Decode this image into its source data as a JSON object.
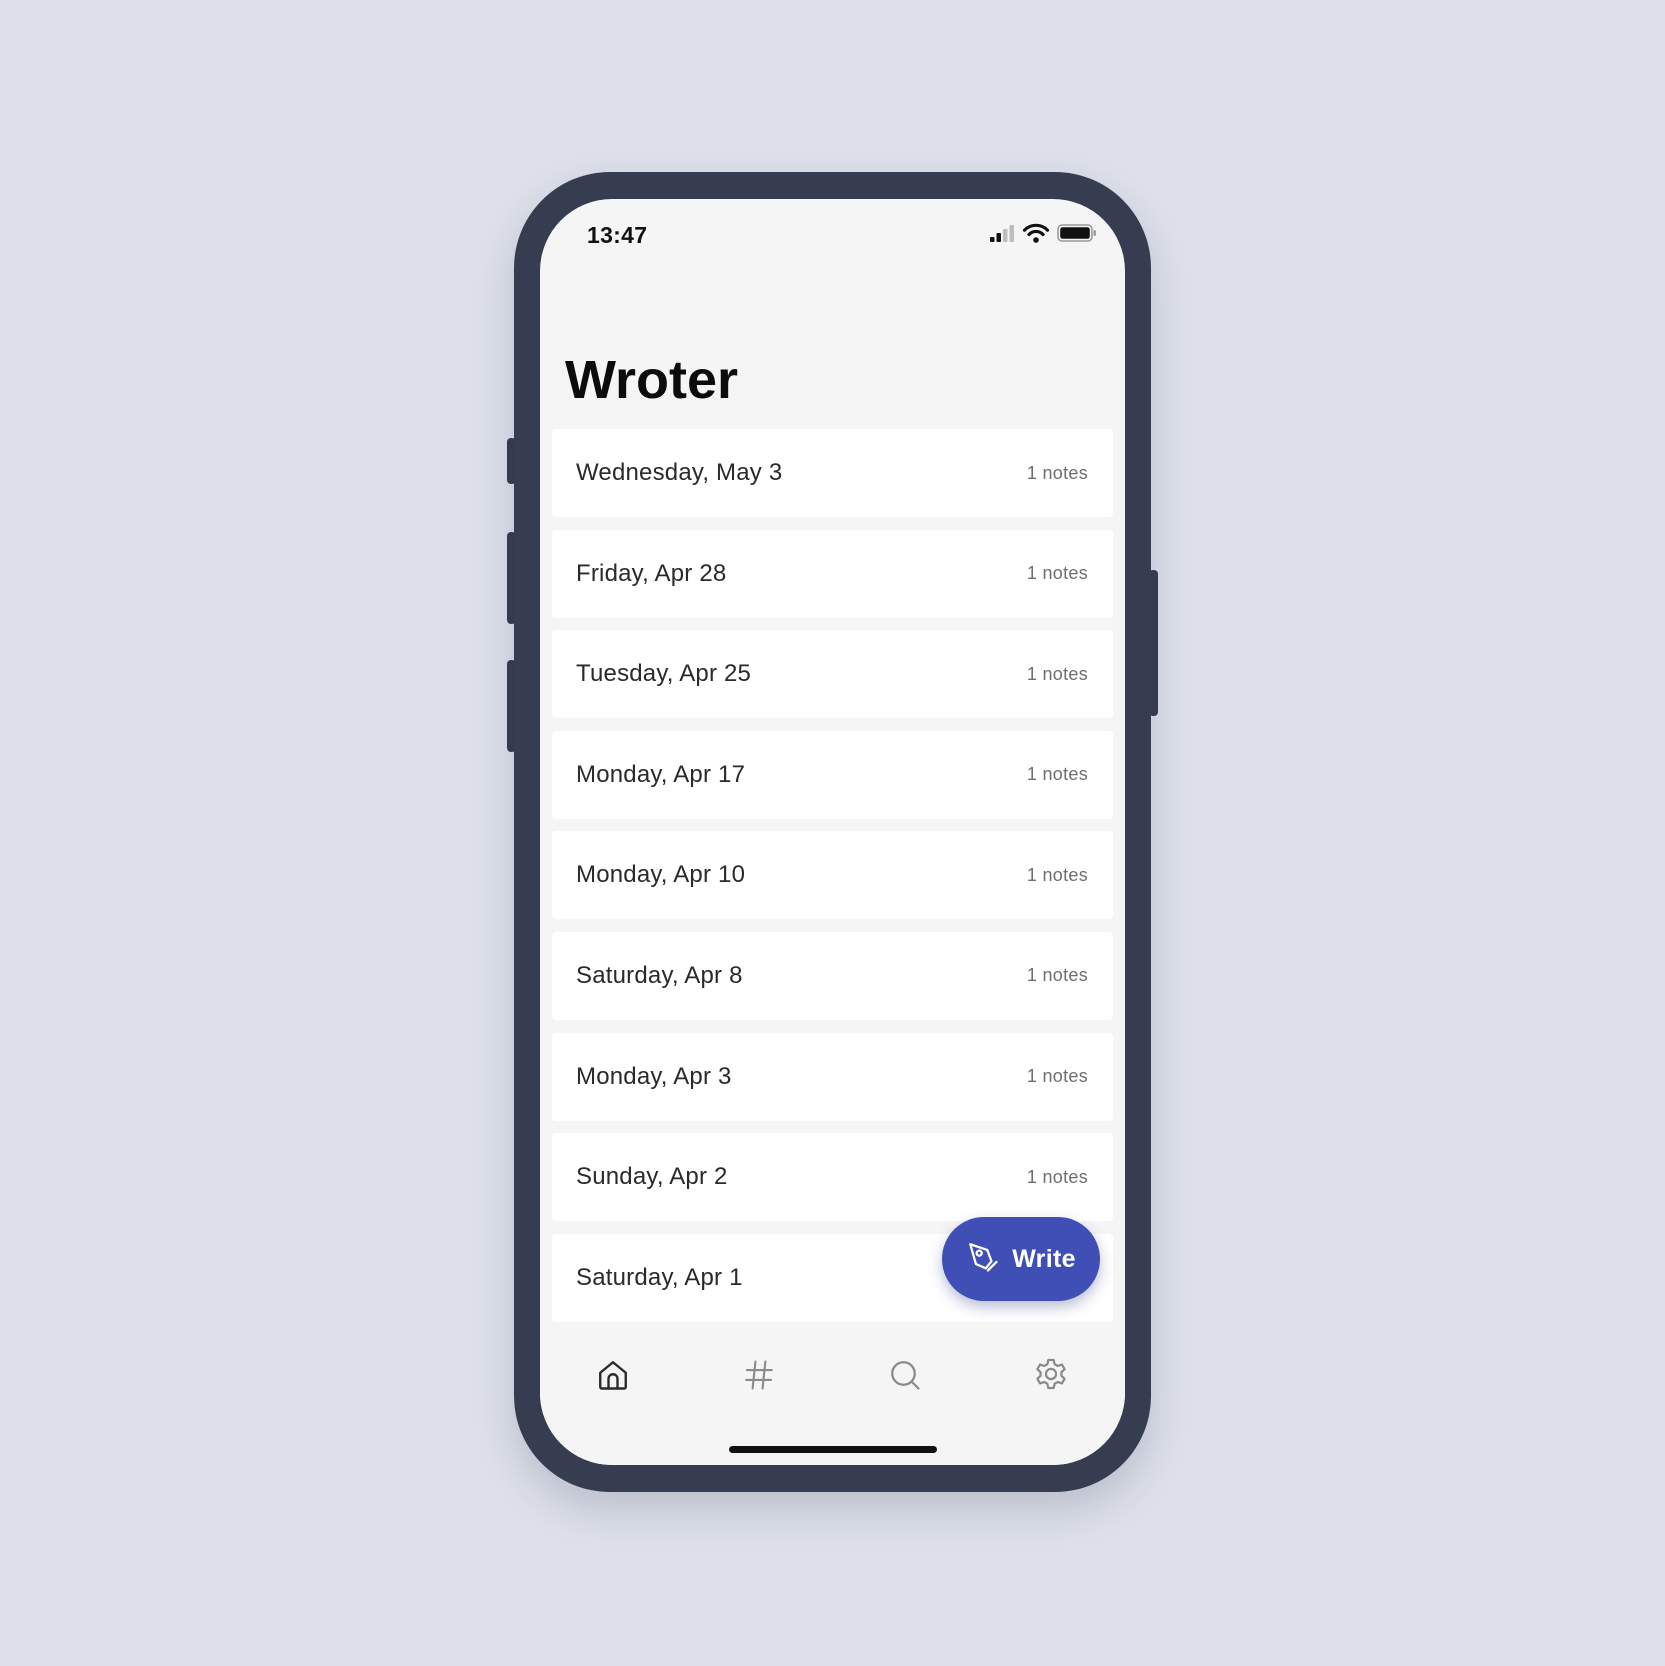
{
  "status_bar": {
    "time": "13:47",
    "icons": [
      "signal-icon",
      "wifi-icon",
      "battery-icon"
    ]
  },
  "app": {
    "title": "Wroter"
  },
  "days": [
    {
      "label": "Wednesday, May 3",
      "count": "1 notes"
    },
    {
      "label": "Friday, Apr 28",
      "count": "1 notes"
    },
    {
      "label": "Tuesday, Apr 25",
      "count": "1 notes"
    },
    {
      "label": "Monday, Apr 17",
      "count": "1 notes"
    },
    {
      "label": "Monday, Apr 10",
      "count": "1 notes"
    },
    {
      "label": "Saturday, Apr 8",
      "count": "1 notes"
    },
    {
      "label": "Monday, Apr 3",
      "count": "1 notes"
    },
    {
      "label": "Sunday, Apr 2",
      "count": "1 notes"
    },
    {
      "label": "Saturday, Apr 1",
      "count": ""
    }
  ],
  "fab": {
    "label": "Write",
    "icon": "pen-nib-icon"
  },
  "tabs": [
    {
      "name": "home",
      "icon": "home-icon",
      "active": true
    },
    {
      "name": "tags",
      "icon": "hashtag-icon",
      "active": false
    },
    {
      "name": "search",
      "icon": "search-icon",
      "active": false
    },
    {
      "name": "settings",
      "icon": "gear-icon",
      "active": false
    }
  ],
  "colors": {
    "page_background": "#dde0ea",
    "device_frame": "#373d50",
    "screen_background": "#f5f5f5",
    "card_background": "#ffffff",
    "accent": "#3f4fb5",
    "tab_active": "#2b2b2b",
    "tab_inactive": "#8a8a8a"
  }
}
